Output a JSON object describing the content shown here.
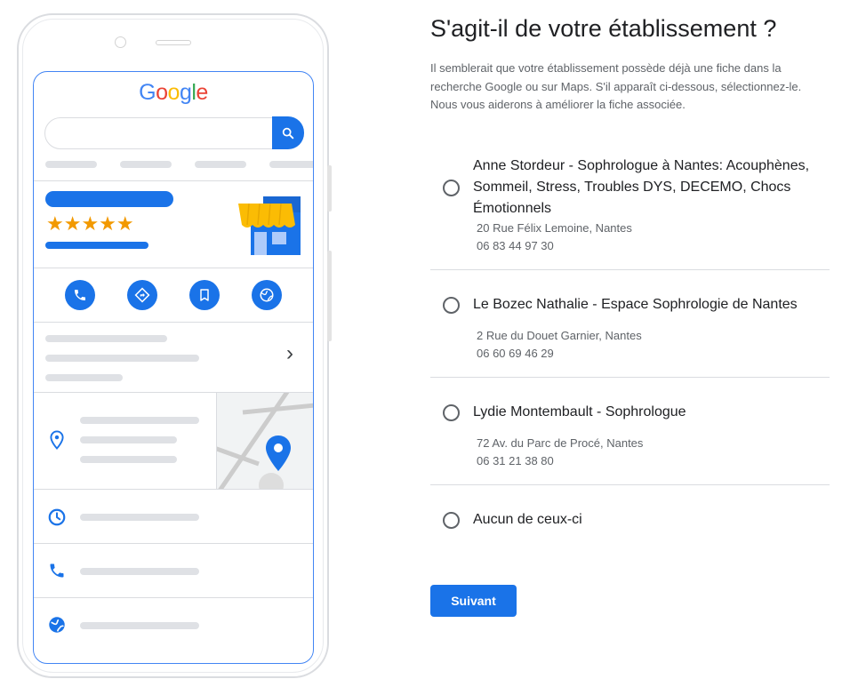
{
  "illustration": {
    "logo_letters": [
      {
        "char": "G",
        "color": "#4285f4"
      },
      {
        "char": "o",
        "color": "#ea4335"
      },
      {
        "char": "o",
        "color": "#fbbc05"
      },
      {
        "char": "g",
        "color": "#4285f4"
      },
      {
        "char": "l",
        "color": "#34a853"
      },
      {
        "char": "e",
        "color": "#ea4335"
      }
    ],
    "rating_stars": 5,
    "stars_text": "★★★★★",
    "action_icons": [
      "phone-icon",
      "directions-icon",
      "bookmark-icon",
      "globe-icon"
    ],
    "info_icons": [
      "location-pin-icon",
      "clock-icon",
      "phone-icon",
      "globe-icon"
    ],
    "chevron": "›"
  },
  "page": {
    "title": "S'agit-il de votre établissement ?",
    "intro": "Il semblerait que votre établissement possède déjà une fiche dans la recherche Google ou sur Maps. S'il apparaît ci-dessous, sélectionnez-le. Nous vous aiderons à améliorer la fiche associée."
  },
  "options": [
    {
      "name": "Anne Stordeur - Sophrologue à Nantes: Acouphènes, Sommeil, Stress, Troubles DYS, DECEMO, Chocs Émotionnels",
      "address": "20 Rue Félix Lemoine, Nantes",
      "phone": "06 83 44 97 30"
    },
    {
      "name": "Le Bozec Nathalie - Espace Sophrologie de Nantes",
      "address": "2 Rue du Douet Garnier, Nantes",
      "phone": "06 60 69 46 29"
    },
    {
      "name": "Lydie Montembault - Sophrologue",
      "address": "72 Av. du Parc de Procé, Nantes",
      "phone": "06 31 21 38 80"
    },
    {
      "name": "Aucun de ceux-ci"
    }
  ],
  "buttons": {
    "next": "Suivant"
  },
  "colors": {
    "accent": "#1a73e8",
    "star": "#f29900",
    "divider": "#dadce0"
  }
}
